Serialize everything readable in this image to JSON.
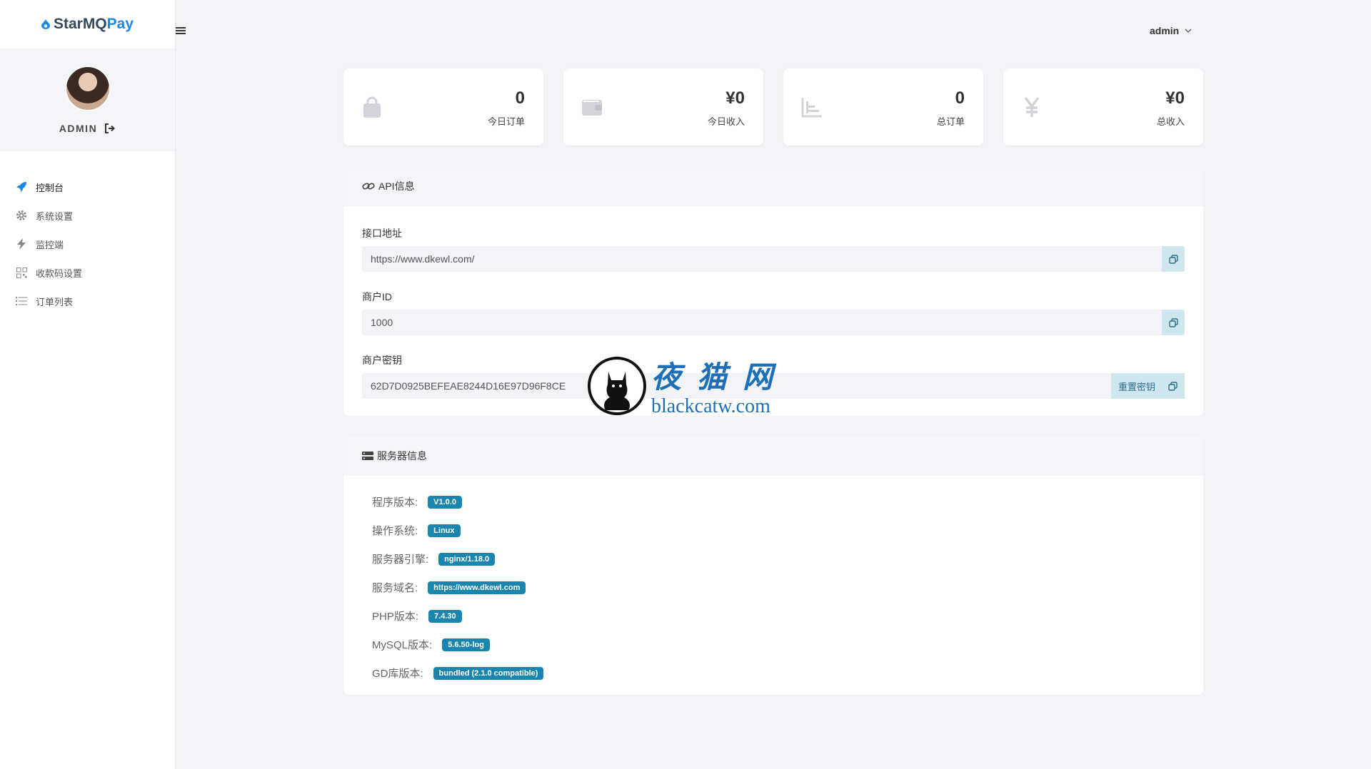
{
  "brand": {
    "part1": "StarMQ",
    "part2": "Pay"
  },
  "user": {
    "name": "ADMIN"
  },
  "nav": [
    {
      "label": "控制台",
      "icon": "rocket-icon"
    },
    {
      "label": "系统设置",
      "icon": "gear-icon"
    },
    {
      "label": "监控端",
      "icon": "bolt-icon"
    },
    {
      "label": "收款码设置",
      "icon": "qrcode-icon"
    },
    {
      "label": "订单列表",
      "icon": "list-icon"
    }
  ],
  "header": {
    "admin": "admin"
  },
  "stats": [
    {
      "value": "0",
      "label": "今日订单",
      "icon": "shopping-bag-icon"
    },
    {
      "value": "¥0",
      "label": "今日收入",
      "icon": "wallet-icon"
    },
    {
      "value": "0",
      "label": "总订单",
      "icon": "chart-icon"
    },
    {
      "value": "¥0",
      "label": "总收入",
      "icon": "yen-icon"
    }
  ],
  "api": {
    "title": "API信息",
    "endpoint_label": "接口地址",
    "endpoint": "https://www.dkewl.com/",
    "merchant_id_label": "商户ID",
    "merchant_id": "1000",
    "key_label": "商户密钥",
    "key": "62D7D0925BEFEAE8244D16E97D96F8CE",
    "reset_key": "重置密钥"
  },
  "server": {
    "title": "服务器信息",
    "rows": [
      {
        "label": "程序版本:",
        "value": "V1.0.0"
      },
      {
        "label": "操作系统:",
        "value": "Linux"
      },
      {
        "label": "服务器引擎:",
        "value": "nginx/1.18.0"
      },
      {
        "label": "服务域名:",
        "value": "https://www.dkewl.com"
      },
      {
        "label": "PHP版本:",
        "value": "7.4.30"
      },
      {
        "label": "MySQL版本:",
        "value": "5.6.50-log"
      },
      {
        "label": "GD库版本:",
        "value": "bundled (2.1.0 compatible)"
      }
    ]
  },
  "watermark": {
    "cn": "夜猫网",
    "en": "blackcatw.com"
  },
  "colors": {
    "accent": "#1e88e5",
    "badge": "#1a86b0",
    "background": "#f2f3f7"
  }
}
